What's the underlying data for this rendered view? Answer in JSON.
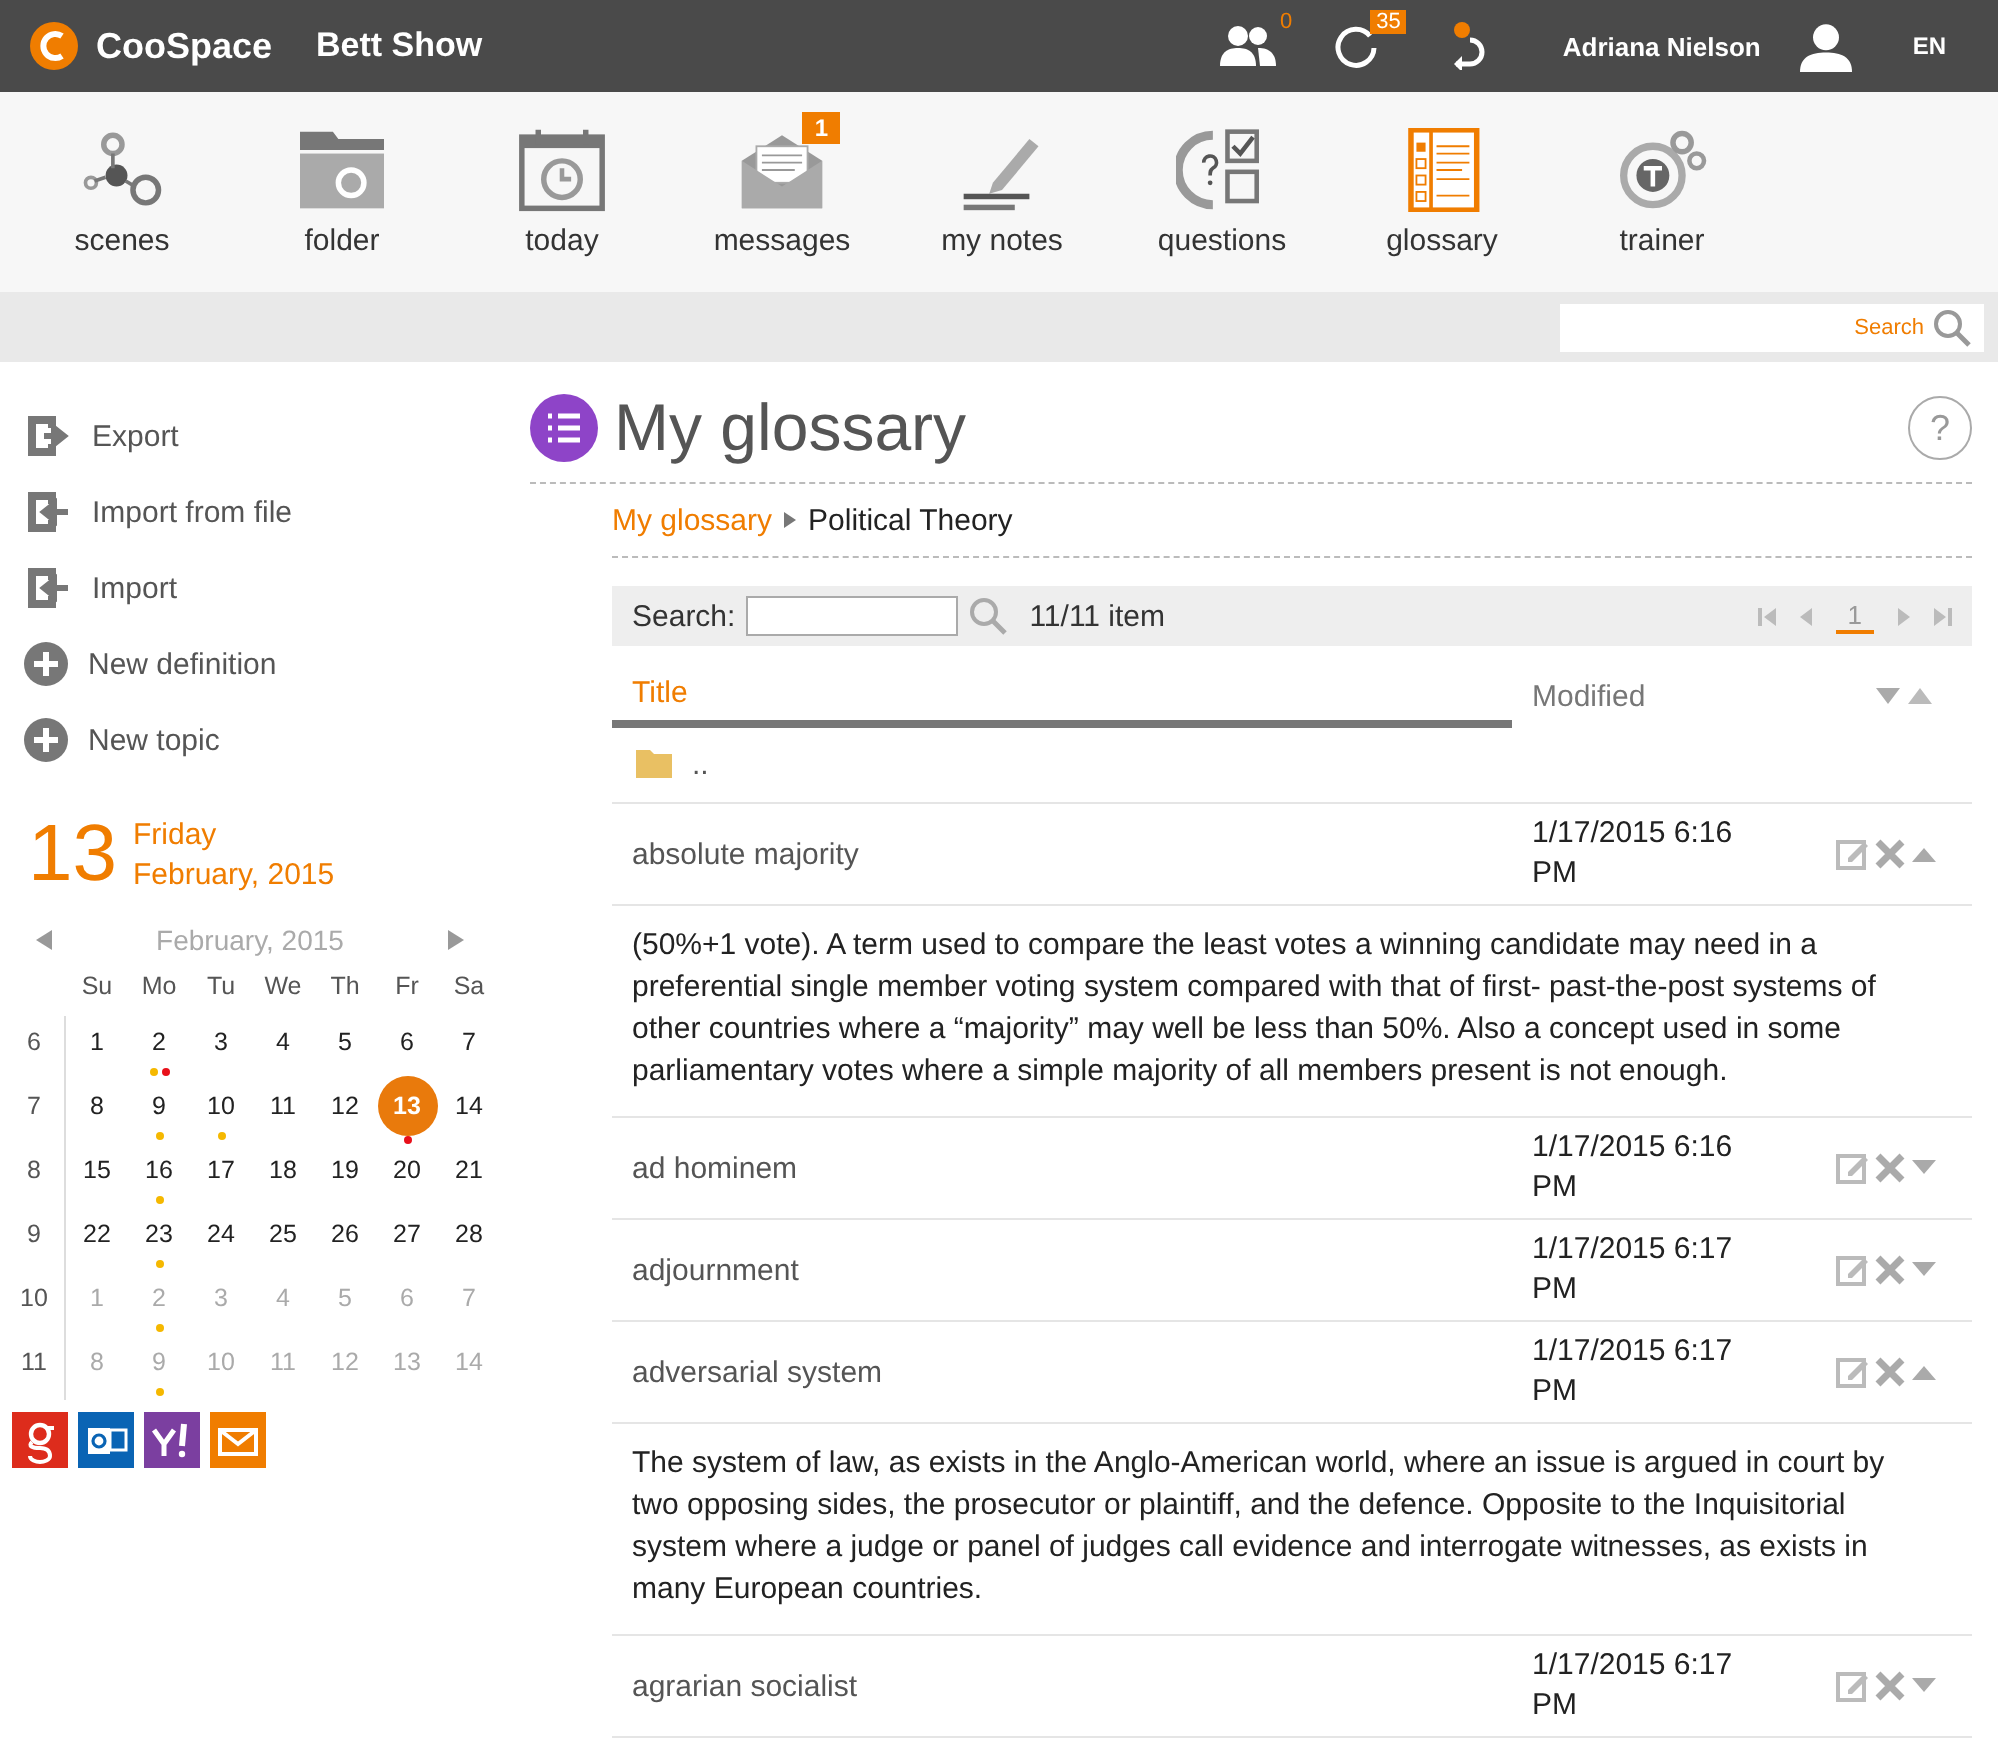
{
  "header": {
    "brand": "CooSpace",
    "course": "Bett Show",
    "notifications": [
      {
        "kind": "people",
        "badge": "0"
      },
      {
        "kind": "sync",
        "badge": "35"
      },
      {
        "kind": "undo"
      }
    ],
    "user": "Adriana Nielson",
    "language": "EN"
  },
  "toolbar": [
    {
      "kind": "scenes",
      "label": "scenes",
      "selected": false
    },
    {
      "kind": "folder",
      "label": "folder",
      "selected": false
    },
    {
      "kind": "today",
      "label": "today",
      "selected": false
    },
    {
      "kind": "messages",
      "label": "messages",
      "selected": false,
      "badge": "1"
    },
    {
      "kind": "notes",
      "label": "my notes",
      "selected": false
    },
    {
      "kind": "questions",
      "label": "questions",
      "selected": false
    },
    {
      "kind": "glossary",
      "label": "glossary",
      "selected": true
    },
    {
      "kind": "trainer",
      "label": "trainer",
      "selected": false
    }
  ],
  "global_search": {
    "placeholder": "Search"
  },
  "sidebar": {
    "actions": [
      {
        "kind": "export",
        "label": "Export"
      },
      {
        "kind": "import",
        "label": "Import from file"
      },
      {
        "kind": "import",
        "label": "Import"
      },
      {
        "kind": "add",
        "label": "New definition"
      },
      {
        "kind": "add",
        "label": "New topic"
      }
    ],
    "date": {
      "day": "13",
      "weekday": "Friday",
      "month_year": "February, 2015"
    },
    "calendar": {
      "title": "February, 2015",
      "weekdays": [
        "Su",
        "Mo",
        "Tu",
        "We",
        "Th",
        "Fr",
        "Sa"
      ],
      "weeks": [
        {
          "number": "6",
          "days": [
            {
              "label": "1",
              "muted": false,
              "selected": false
            },
            {
              "label": "2",
              "muted": false,
              "selected": false,
              "dots": [
                {
                  "color": "#f5b800"
                },
                {
                  "color": "#e8101a"
                }
              ]
            },
            {
              "label": "3",
              "muted": false,
              "selected": false
            },
            {
              "label": "4",
              "muted": false,
              "selected": false
            },
            {
              "label": "5",
              "muted": false,
              "selected": false
            },
            {
              "label": "6",
              "muted": false,
              "selected": false
            },
            {
              "label": "7",
              "muted": false,
              "selected": false
            }
          ]
        },
        {
          "number": "7",
          "days": [
            {
              "label": "8",
              "muted": false,
              "selected": false
            },
            {
              "label": "9",
              "muted": false,
              "selected": false,
              "dots": [
                {
                  "color": "#f5b800"
                }
              ]
            },
            {
              "label": "10",
              "muted": false,
              "selected": false,
              "dots": [
                {
                  "color": "#f5b800"
                }
              ]
            },
            {
              "label": "11",
              "muted": false,
              "selected": false
            },
            {
              "label": "12",
              "muted": false,
              "selected": false
            },
            {
              "label": "13",
              "muted": false,
              "selected": true,
              "dots": [
                {
                  "color": "#e8101a"
                }
              ]
            },
            {
              "label": "14",
              "muted": false,
              "selected": false
            }
          ]
        },
        {
          "number": "8",
          "days": [
            {
              "label": "15",
              "muted": false,
              "selected": false
            },
            {
              "label": "16",
              "muted": false,
              "selected": false,
              "dots": [
                {
                  "color": "#f5b800"
                }
              ]
            },
            {
              "label": "17",
              "muted": false,
              "selected": false
            },
            {
              "label": "18",
              "muted": false,
              "selected": false
            },
            {
              "label": "19",
              "muted": false,
              "selected": false
            },
            {
              "label": "20",
              "muted": false,
              "selected": false
            },
            {
              "label": "21",
              "muted": false,
              "selected": false
            }
          ]
        },
        {
          "number": "9",
          "days": [
            {
              "label": "22",
              "muted": false,
              "selected": false
            },
            {
              "label": "23",
              "muted": false,
              "selected": false,
              "dots": [
                {
                  "color": "#f5b800"
                }
              ]
            },
            {
              "label": "24",
              "muted": false,
              "selected": false
            },
            {
              "label": "25",
              "muted": false,
              "selected": false
            },
            {
              "label": "26",
              "muted": false,
              "selected": false
            },
            {
              "label": "27",
              "muted": false,
              "selected": false
            },
            {
              "label": "28",
              "muted": false,
              "selected": false
            }
          ]
        },
        {
          "number": "10",
          "days": [
            {
              "label": "1",
              "muted": true,
              "selected": false
            },
            {
              "label": "2",
              "muted": true,
              "selected": false,
              "dots": [
                {
                  "color": "#f5b800"
                }
              ]
            },
            {
              "label": "3",
              "muted": true,
              "selected": false
            },
            {
              "label": "4",
              "muted": true,
              "selected": false
            },
            {
              "label": "5",
              "muted": true,
              "selected": false
            },
            {
              "label": "6",
              "muted": true,
              "selected": false
            },
            {
              "label": "7",
              "muted": true,
              "selected": false
            }
          ]
        },
        {
          "number": "11",
          "days": [
            {
              "label": "8",
              "muted": true,
              "selected": false
            },
            {
              "label": "9",
              "muted": true,
              "selected": false,
              "dots": [
                {
                  "color": "#f5b800"
                }
              ]
            },
            {
              "label": "10",
              "muted": true,
              "selected": false
            },
            {
              "label": "11",
              "muted": true,
              "selected": false
            },
            {
              "label": "12",
              "muted": true,
              "selected": false
            },
            {
              "label": "13",
              "muted": true,
              "selected": false
            },
            {
              "label": "14",
              "muted": true,
              "selected": false
            }
          ]
        }
      ]
    },
    "calendar_links": [
      {
        "kind": "google"
      },
      {
        "kind": "outlook"
      },
      {
        "kind": "yahoo"
      },
      {
        "kind": "mail"
      }
    ]
  },
  "page_title": "My glossary",
  "help_button": "?",
  "breadcrumb": [
    {
      "label": "My glossary",
      "link": true
    },
    {
      "label": "Political Theory",
      "link": false
    }
  ],
  "list_search": {
    "label": "Search:",
    "count": "11/11 item"
  },
  "pager": {
    "page": "1"
  },
  "table": {
    "columns": [
      {
        "label": "Title",
        "sorted": true
      },
      {
        "label": "Modified",
        "sorted": false
      }
    ],
    "parent_row": "..",
    "rows": [
      {
        "title": "absolute majority",
        "modified": "1/17/2015 6:16 PM",
        "expanded": true,
        "definition": "(50%+1 vote). A term used to compare the least votes a winning candidate may need in a preferential single member voting system compared with that of first- past-the-post systems of other countries where a “majority” may well be less than 50%.  Also a concept used in some parliamentary votes where a simple majority of all members present is not enough."
      },
      {
        "title": "ad hominem",
        "modified": "1/17/2015 6:16 PM",
        "expanded": false
      },
      {
        "title": "adjournment",
        "modified": "1/17/2015 6:17 PM",
        "expanded": false
      },
      {
        "title": "adversarial system",
        "modified": "1/17/2015 6:17 PM",
        "expanded": true,
        "definition": "The system of law, as exists in the Anglo-American world, where an issue is argued in court by two opposing sides, the prosecutor or plaintiff, and the defence. Opposite to the Inquisitorial system where a judge or panel of judges call evidence and interrogate witnesses, as exists in many European countries."
      },
      {
        "title": "agrarian socialist",
        "modified": "1/17/2015 6:17 PM",
        "expanded": false
      }
    ]
  }
}
